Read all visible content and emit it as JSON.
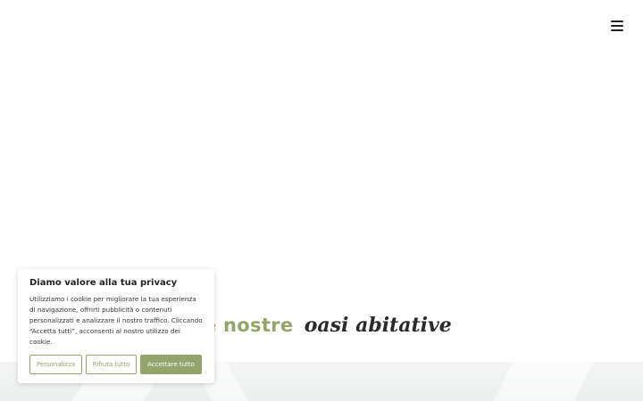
{
  "header": {
    "menu_icon": "hamburger-menu-icon"
  },
  "hero": {
    "title_plain": "Le nostre",
    "title_script": "oasi abitative",
    "accent_color": "#93a56b"
  },
  "cookie_banner": {
    "title": "Diamo valore alla tua privacy",
    "text": "Utilizziamo i cookie per migliorare la tua esperienza di navigazione, offrirti pubblicità o contenuti personalizzati e analizzare il nostro traffico. Cliccando “Accetta tutti”, acconsenti al nostro utilizzo dei cookie.",
    "customize_label": "Personalizza",
    "reject_label": "Rifiuta tutto",
    "accept_label": "Accettare tutto"
  }
}
